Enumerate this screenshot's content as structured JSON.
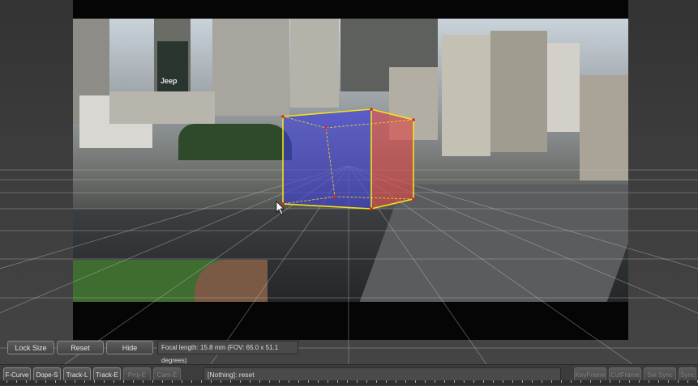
{
  "viewport": {
    "cursor": "arrow-cursor"
  },
  "toolbar": {
    "lock_size_label": "Lock Size",
    "reset_label": "Reset",
    "hide_label": "Hide",
    "focal_status": "Focal length: 15.8 mm (FOV: 65.0 x 51.1 degrees)"
  },
  "bottom_bar": {
    "buttons_left": [
      "F-Curve",
      "Dope-S",
      "Track-L",
      "Track-E",
      "Proj-E",
      "Cam-E"
    ],
    "status_text": "[Nothing]: reset",
    "buttons_right": [
      "KeyFrame",
      "CutFrame",
      "Sel Sync",
      "Sync"
    ]
  },
  "billboard": {
    "brand": "Jeep"
  },
  "colors": {
    "cube_front": "#4a4ae0",
    "cube_side": "#e04a4a",
    "cube_edge": "#f2e21a"
  }
}
